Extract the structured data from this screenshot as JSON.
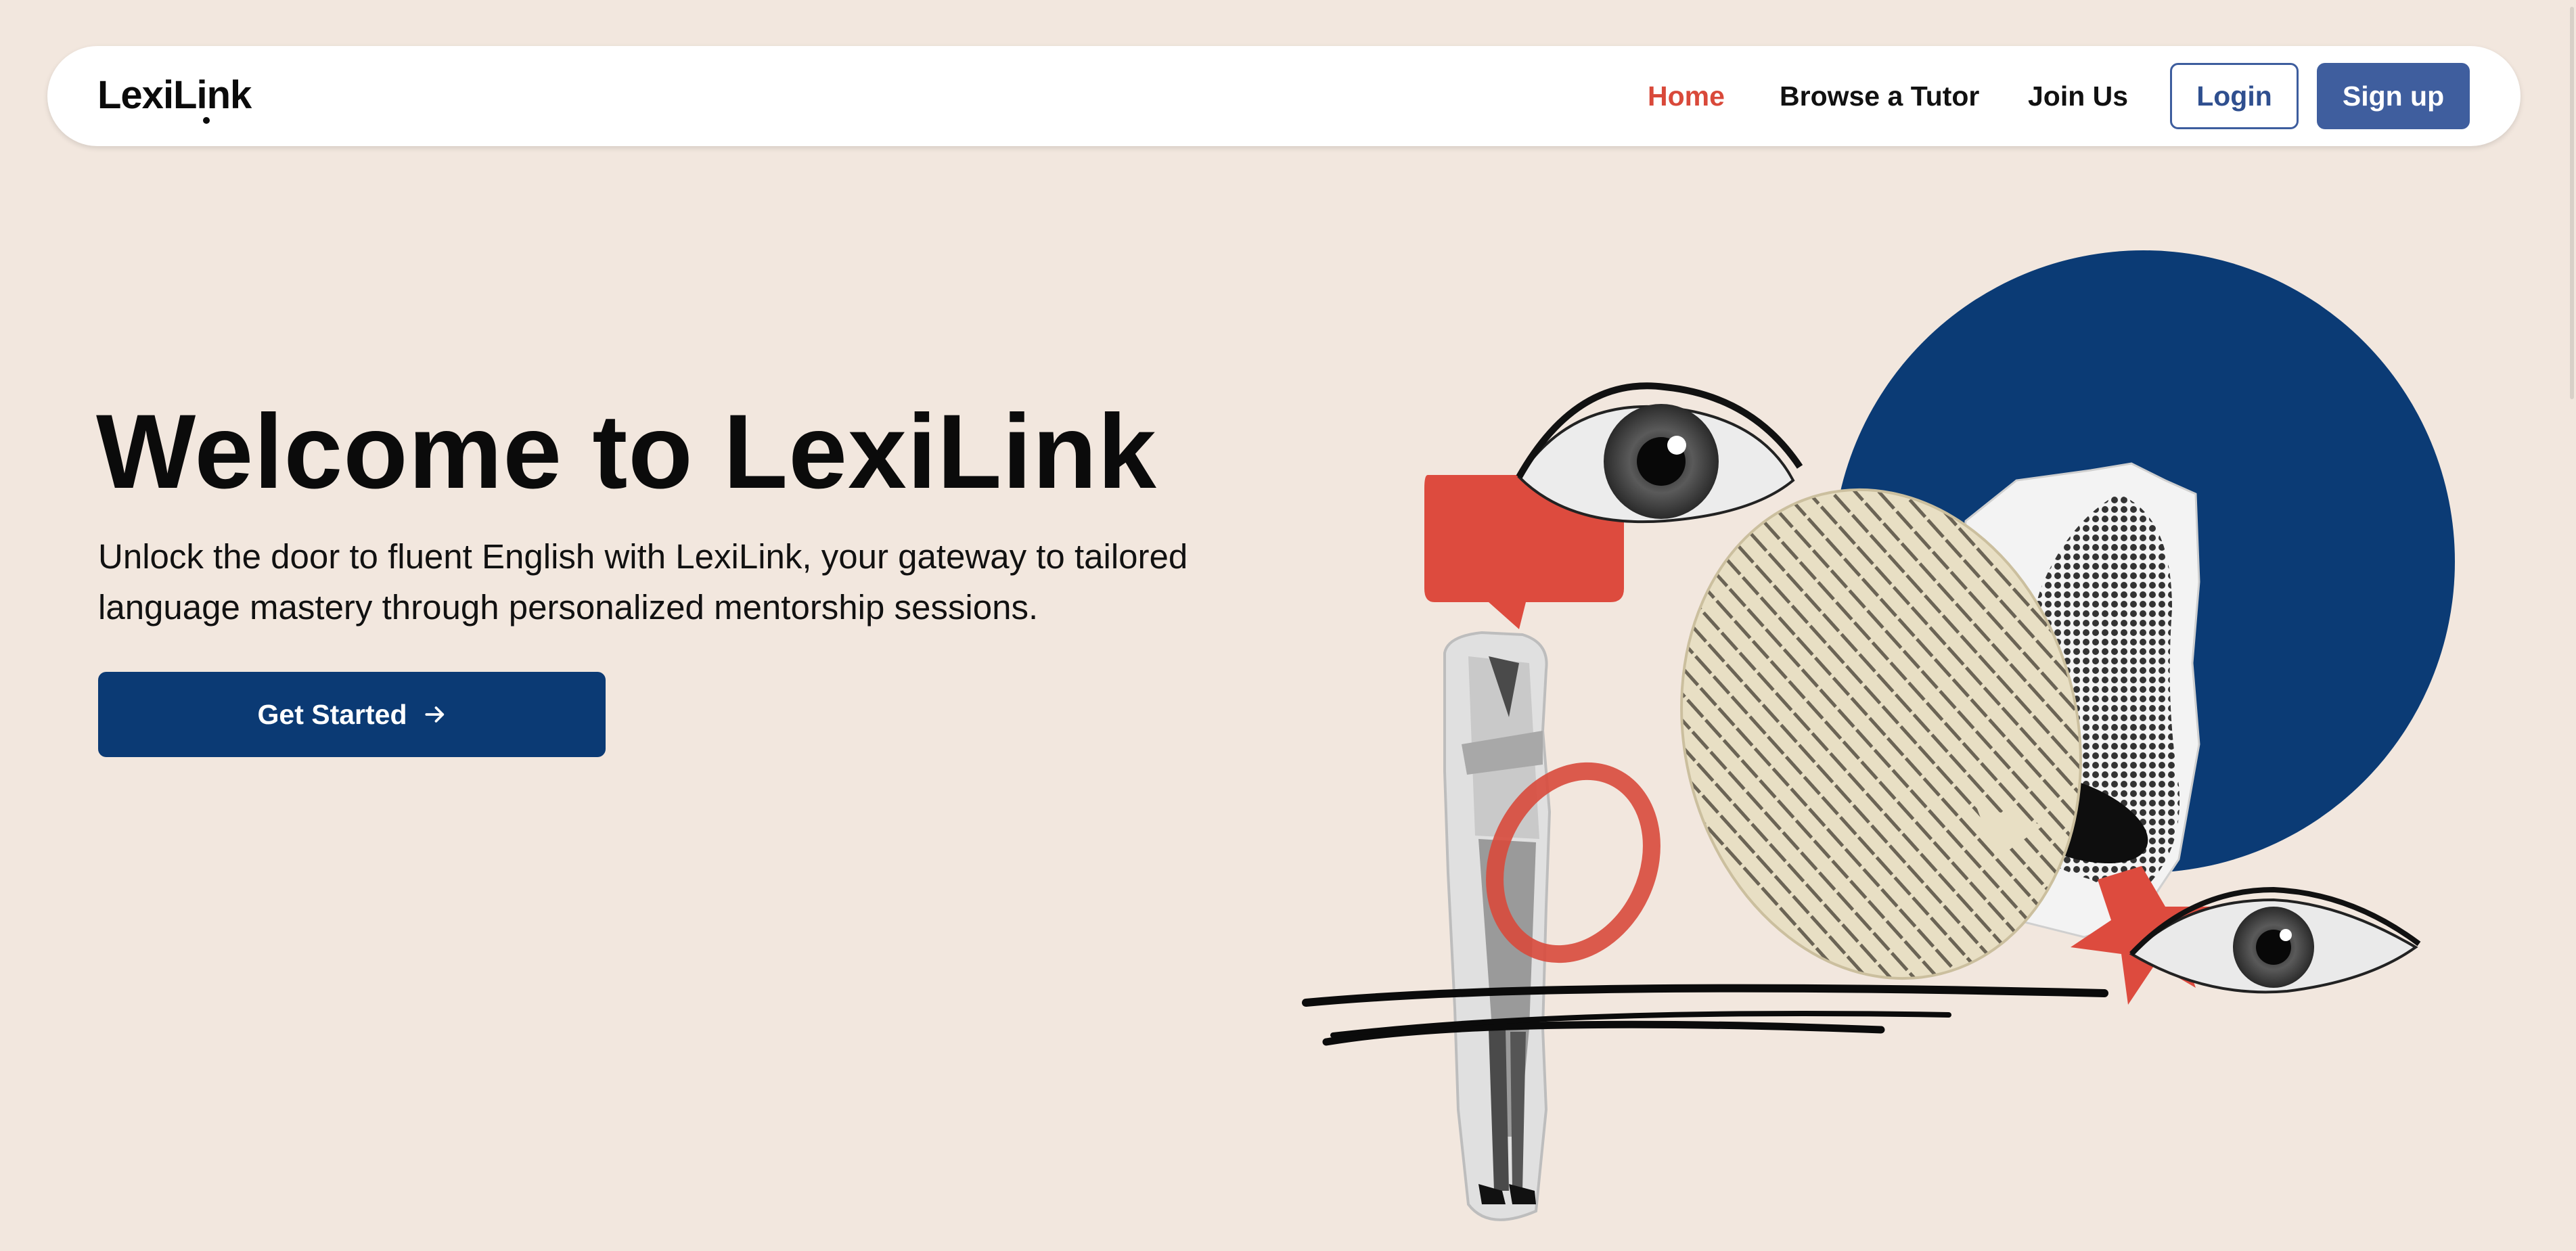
{
  "brand": {
    "logo_text": "LexiLink"
  },
  "nav": {
    "items": [
      {
        "label": "Home",
        "active": true
      },
      {
        "label": "Browse a Tutor",
        "active": false
      },
      {
        "label": "Join Us",
        "active": false
      }
    ],
    "login_label": "Login",
    "signup_label": "Sign up"
  },
  "hero": {
    "title": "Welcome to LexiLink",
    "subtitle": "Unlock the door to fluent English with LexiLink, your gateway to tailored language mastery through personalized mentorship sessions.",
    "cta_label": "Get Started",
    "cta_icon": "arrow-right-icon"
  },
  "colors": {
    "background": "#f2e7de",
    "accent_red": "#d9493a",
    "primary_blue": "#0b3a74",
    "button_blue": "#3f5e9e"
  }
}
